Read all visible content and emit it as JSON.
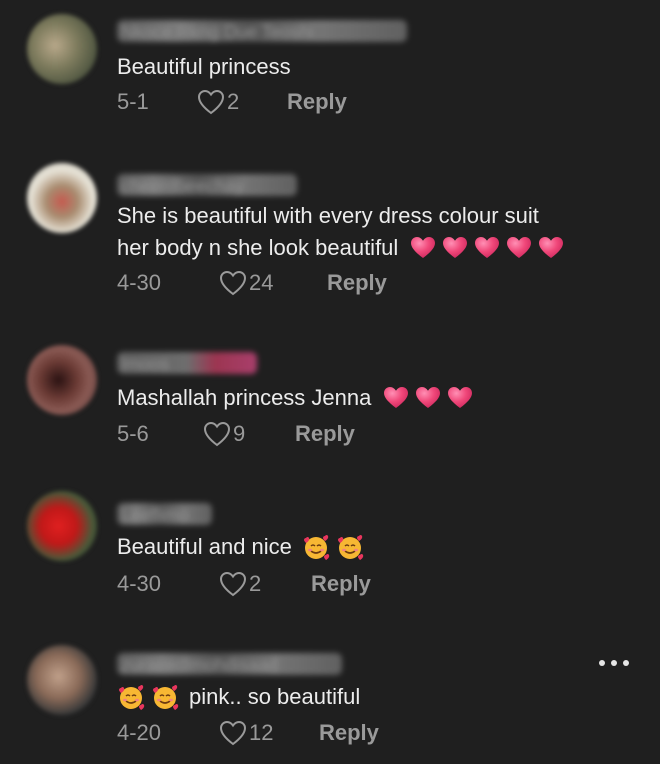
{
  "comments": [
    {
      "username": "Nkoce Rkng Due Teoshi",
      "text": "Beautiful princess",
      "emojis_after": [],
      "emojis_before": [],
      "date": "5-1",
      "likes": "2",
      "reply_label": "Reply"
    },
    {
      "username": "cheerdbeechay",
      "text_line1": "She is beautiful with every dress colour suit",
      "text_line2": "her body n she look beautiful",
      "emojis_after": [
        "heart",
        "heart",
        "heart",
        "heart",
        "heart"
      ],
      "date": "4-30",
      "likes": "24",
      "reply_label": "Reply"
    },
    {
      "username": "lmoos",
      "text": "Mashallah princess Jenna",
      "emojis_after": [
        "heart",
        "heart",
        "heart"
      ],
      "date": "5-6",
      "likes": "9",
      "reply_label": "Reply"
    },
    {
      "username": "Leeflimo",
      "text": "Beautiful and nice",
      "emojis_after": [
        "smiling-face-with-hearts",
        "smiling-face-with-hearts"
      ],
      "date": "4-30",
      "likes": "2",
      "reply_label": "Reply"
    },
    {
      "username": "zuraeedlmohdisaad",
      "text": "pink.. so beautiful",
      "emojis_before": [
        "smiling-face-with-hearts",
        "smiling-face-with-hearts"
      ],
      "date": "4-20",
      "likes": "12",
      "reply_label": "Reply"
    }
  ],
  "colors": {
    "background": "#1f1f1f",
    "text": "#ececec",
    "meta": "#9a9a9a",
    "heart_emoji": "#f0487a"
  },
  "icons": {
    "like": "heart-outline-icon",
    "more": "more-dots-icon"
  }
}
